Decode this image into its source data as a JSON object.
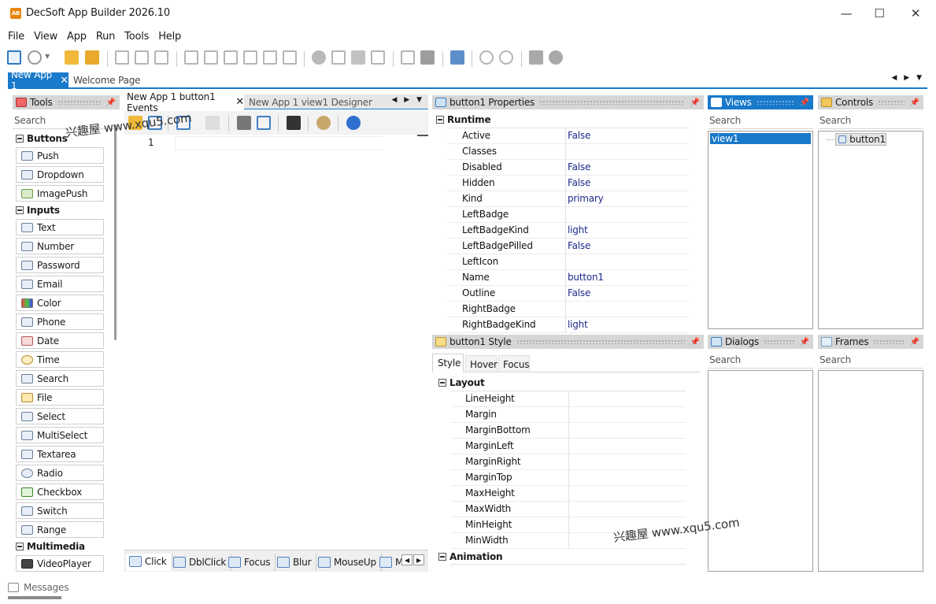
{
  "window": {
    "title": "DecSoft App Builder 2026.10",
    "icon_text": "AB"
  },
  "window_controls": {
    "minimize": "—",
    "maximize": "☐",
    "close": "✕"
  },
  "menu": [
    "File",
    "View",
    "App",
    "Run",
    "Tools",
    "Help"
  ],
  "doc_tabs": {
    "active": "New App 1",
    "inactive": "Welcome Page",
    "close": "✕",
    "nav": "◀ ▶ ▼"
  },
  "tools_panel": {
    "title": "Tools",
    "search_placeholder": "Search",
    "groups": [
      {
        "name": "Buttons",
        "items": [
          "Push",
          "Dropdown",
          "ImagePush"
        ]
      },
      {
        "name": "Inputs",
        "items": [
          "Text",
          "Number",
          "Password",
          "Email",
          "Color",
          "Phone",
          "Date",
          "Time",
          "Search",
          "File",
          "Select",
          "MultiSelect",
          "Textarea",
          "Radio",
          "Checkbox",
          "Switch",
          "Range"
        ]
      },
      {
        "name": "Multimedia",
        "items": [
          "VideoPlayer"
        ]
      }
    ]
  },
  "editor": {
    "tabs": [
      "New App 1 button1 Events",
      "New App 1 view1 Designer"
    ],
    "line_number": "1",
    "bottom_tabs": [
      "Click",
      "DblClick",
      "Focus",
      "Blur",
      "MouseUp",
      "M"
    ]
  },
  "properties_panel": {
    "title": "button1 Properties",
    "category": "Runtime",
    "rows": [
      {
        "name": "Active",
        "value": "False"
      },
      {
        "name": "Classes",
        "value": ""
      },
      {
        "name": "Disabled",
        "value": "False"
      },
      {
        "name": "Hidden",
        "value": "False"
      },
      {
        "name": "Kind",
        "value": "primary"
      },
      {
        "name": "LeftBadge",
        "value": ""
      },
      {
        "name": "LeftBadgeKind",
        "value": "light"
      },
      {
        "name": "LeftBadgePilled",
        "value": "False"
      },
      {
        "name": "LeftIcon",
        "value": ""
      },
      {
        "name": "Name",
        "value": "button1"
      },
      {
        "name": "Outline",
        "value": "False"
      },
      {
        "name": "RightBadge",
        "value": ""
      },
      {
        "name": "RightBadgeKind",
        "value": "light"
      }
    ]
  },
  "style_panel": {
    "title": "button1 Style",
    "tabs": [
      "Style",
      "Hover",
      "Focus"
    ],
    "category": "Layout",
    "rows": [
      "LineHeight",
      "Margin",
      "MarginBottom",
      "MarginLeft",
      "MarginRight",
      "MarginTop",
      "MaxHeight",
      "MaxWidth",
      "MinHeight",
      "MinWidth"
    ],
    "category2": "Animation"
  },
  "views_panel": {
    "title": "Views",
    "search_placeholder": "Search",
    "items": [
      "view1"
    ]
  },
  "controls_panel": {
    "title": "Controls",
    "search_placeholder": "Search",
    "items": [
      "button1"
    ]
  },
  "dialogs_panel": {
    "title": "Dialogs",
    "search_placeholder": "Search"
  },
  "frames_panel": {
    "title": "Frames",
    "search_placeholder": "Search"
  },
  "status": {
    "messages": "Messages"
  },
  "watermarks": [
    "兴趣屋 www.xqu5.com",
    "兴趣屋 www.xqu5.com"
  ],
  "colors": {
    "accent": "#1979ca",
    "panel_header": "#d6d6d6",
    "value_text": "#1d2a8a"
  }
}
